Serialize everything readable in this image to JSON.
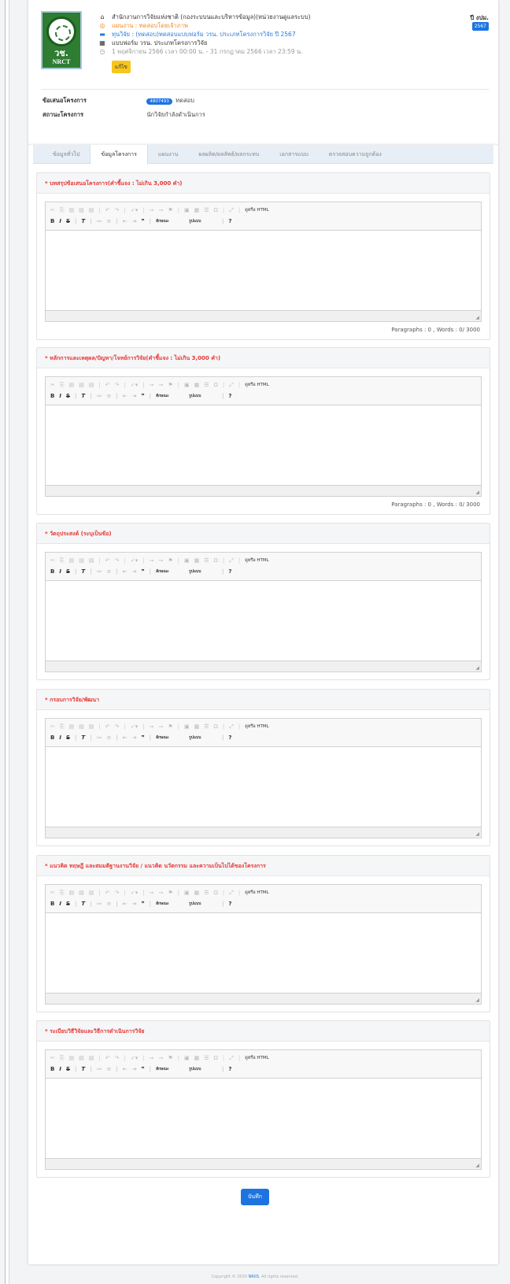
{
  "header": {
    "logo_text_1": "วช.",
    "logo_text_2": "NRCT",
    "org": "สำนักงานการวิจัยแห่งชาติ (กองระบบนและบริหารข้อมูล)(หน่วยงานดูแลระบบ)",
    "plan": "แผนงาน : ทดสอบโดยเจ้าภาพ",
    "fund": "ทุนวิจัย : (ทดสอบ)ทดสอบแบบฟอร์ม วรน. ประเภทโครงการวิจัย ปี 2567",
    "form": "แบบฟอร์ม วรน. ประเภทโครงการวิจัย",
    "period": "1 พฤศจิกายน 2566 เวลา 00:00 น. - 31 กรกฎาคม 2566 เวลา 23:59 น.",
    "edit_label": "แก้ไข",
    "year_label": "ปี งปม.",
    "year_value": "2567",
    "proposal_key": "ข้อเสนอโครงการ",
    "proposal_code": "4807493",
    "proposal_value": "ทดสอบ",
    "status_key": "สถานะโครงการ",
    "status_value": "นักวิจัยกำลังดำเนินการ"
  },
  "tabs": [
    {
      "label": "ข้อมูลทั่วไป",
      "active": false
    },
    {
      "label": "ข้อมูลโครงการ",
      "active": true
    },
    {
      "label": "แผนงาน",
      "active": false
    },
    {
      "label": "ผลผลิต/ผลลัพธ์/ผลกระทบ",
      "active": false
    },
    {
      "label": "เอกสารแนบ",
      "active": false
    },
    {
      "label": "ตรวจสอบความถูกต้อง",
      "active": false
    }
  ],
  "editor_toolbar": {
    "source_label": "ดูหรือ HTML",
    "font_combo": "ลักษณะ",
    "format_combo": "รูปแบบ",
    "help": "?"
  },
  "sections": [
    {
      "title": "* บทสรุปข้อเสนอโครงการ",
      "note": "(คำชี้แจง : ไม่เกิน 3,000 คำ)",
      "counter": "Paragraphs : 0 , Words : 0/ 3000"
    },
    {
      "title": "* หลักการและเหตุผล/ปัญหา/โจทย์การวิจัย",
      "note": "(คำชี้แจง : ไม่เกิน 3,000 คำ)",
      "counter": "Paragraphs : 0 , Words : 0/ 3000"
    },
    {
      "title": "* วัตถุประสงค์ (ระบุเป็นข้อ)",
      "note": "",
      "counter": ""
    },
    {
      "title": "* กรอบการวิจัย/พัฒนา",
      "note": "",
      "counter": ""
    },
    {
      "title": "* แนวคิด ทฤษฎี และสมมติฐานงานวิจัย / แนวคิด นวัตกรรม และความเป็นไปได้ของโครงการ",
      "note": "",
      "counter": ""
    },
    {
      "title": "* ระเบียบวิธีวิจัยและวิธีการดำเนินการวิจัย",
      "note": "",
      "counter": ""
    }
  ],
  "save_label": "บันทึก",
  "footer": {
    "prefix": "Copyright © 2020",
    "link": "NRIIS",
    "suffix": ". All rights reserved."
  }
}
